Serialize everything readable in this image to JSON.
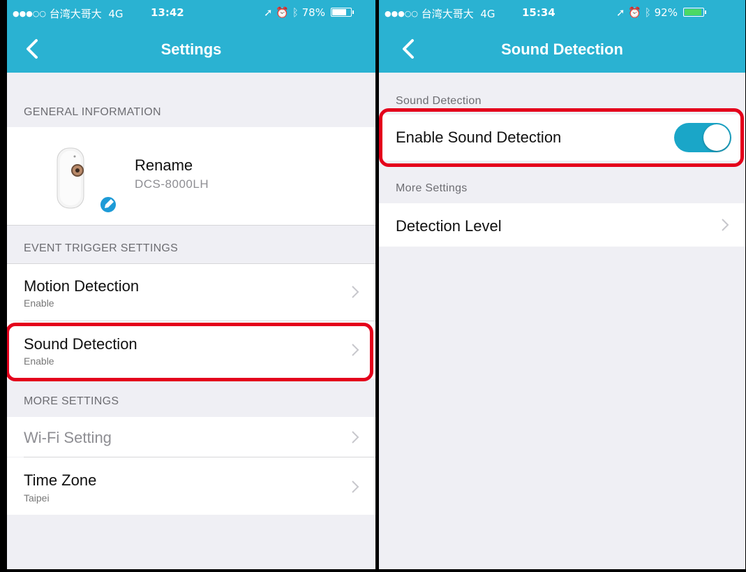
{
  "left_screen": {
    "status": {
      "signal_dots": "●●●○○",
      "carrier": "台湾大哥大",
      "network": "4G",
      "time": "13:42",
      "battery_percent": "78%",
      "battery_level": 0.78
    },
    "nav": {
      "title": "Settings"
    },
    "general_information": {
      "header": "GENERAL INFORMATION",
      "device_name": "Rename",
      "device_model": "DCS-8000LH"
    },
    "event_trigger_settings": {
      "header": "EVENT TRIGGER SETTINGS",
      "motion_detection": {
        "title": "Motion Detection",
        "subtitle": "Enable"
      },
      "sound_detection": {
        "title": "Sound Detection",
        "subtitle": "Enable"
      }
    },
    "more_settings": {
      "header": "MORE SETTINGS",
      "wifi_setting": {
        "title": "Wi-Fi Setting"
      },
      "time_zone": {
        "title": "Time Zone",
        "subtitle": "Taipei"
      }
    }
  },
  "right_screen": {
    "status": {
      "signal_dots": "●●●○○",
      "carrier": "台湾大哥大",
      "network": "4G",
      "time": "15:34",
      "battery_percent": "92%",
      "battery_level": 0.92
    },
    "nav": {
      "title": "Sound Detection"
    },
    "sound_detection": {
      "header": "Sound Detection",
      "enable_label": "Enable Sound Detection",
      "enabled": true
    },
    "more_settings": {
      "header": "More Settings",
      "detection_level": "Detection Level"
    }
  },
  "colors": {
    "nav_bar": "#2ab2d2",
    "toggle_on": "#1aa6c8",
    "highlight": "#e4001b",
    "background": "#efeff4"
  },
  "icons": [
    "chevron-left-icon",
    "chevron-right-icon",
    "location-arrow-icon",
    "alarm-icon",
    "bluetooth-icon",
    "battery-icon",
    "edit-pencil-icon",
    "camera-device-image"
  ]
}
